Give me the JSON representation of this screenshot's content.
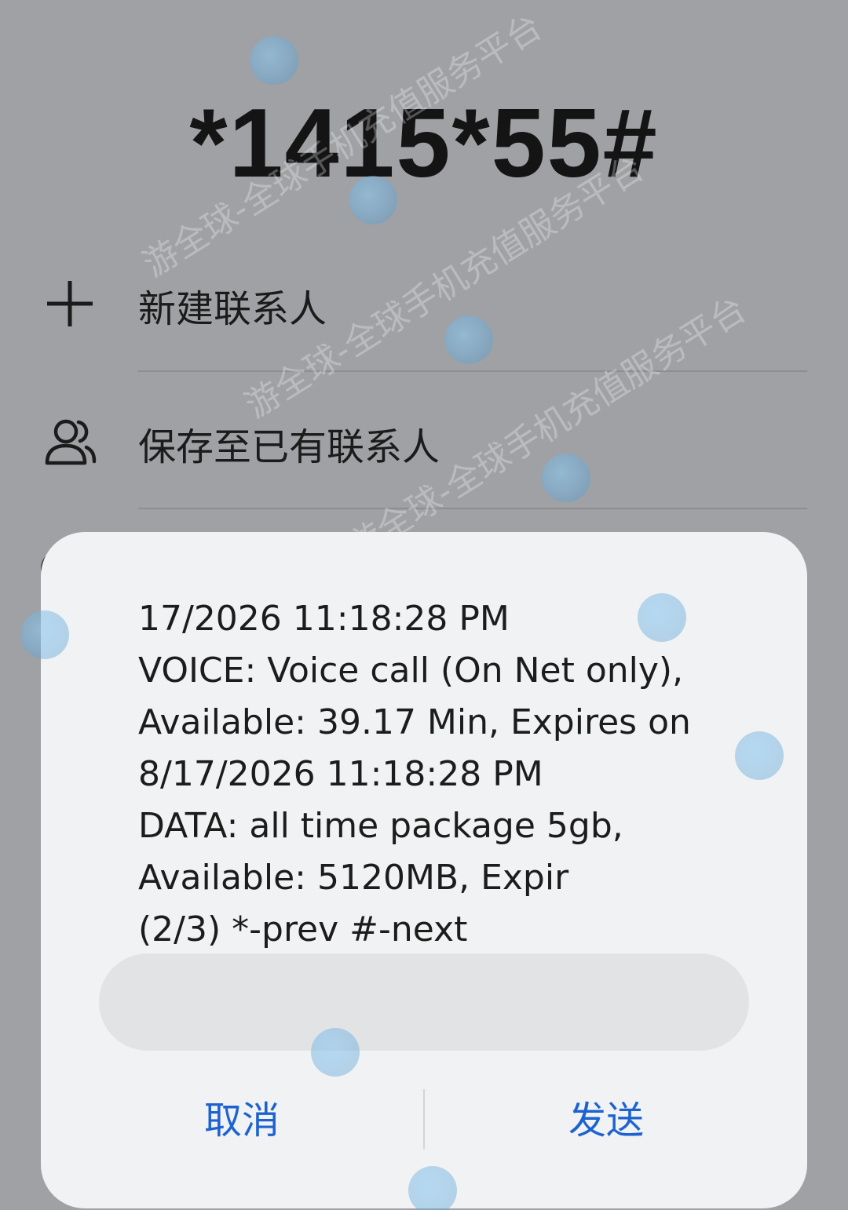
{
  "dialer": {
    "number": "*1415*55#"
  },
  "menu": {
    "new_contact": "新建联系人",
    "save_to_existing": "保存至已有联系人"
  },
  "ussd_dialog": {
    "message": "17/2026 11:18:28 PM\nVOICE: Voice call (On Net only), Available: 39.17 Min, Expires on 8/17/2026 11:18:28 PM\nDATA: all time package 5gb, Available: 5120MB, Expir\n(2/3) *-prev #-next",
    "reply_value": "",
    "cancel_label": "取消",
    "send_label": "发送"
  },
  "watermark": {
    "text": "游全球-全球手机充值服务平台"
  },
  "colors": {
    "background": "#9fa1a4",
    "dialog": "#f1f2f3",
    "accent": "#1d63d0"
  }
}
